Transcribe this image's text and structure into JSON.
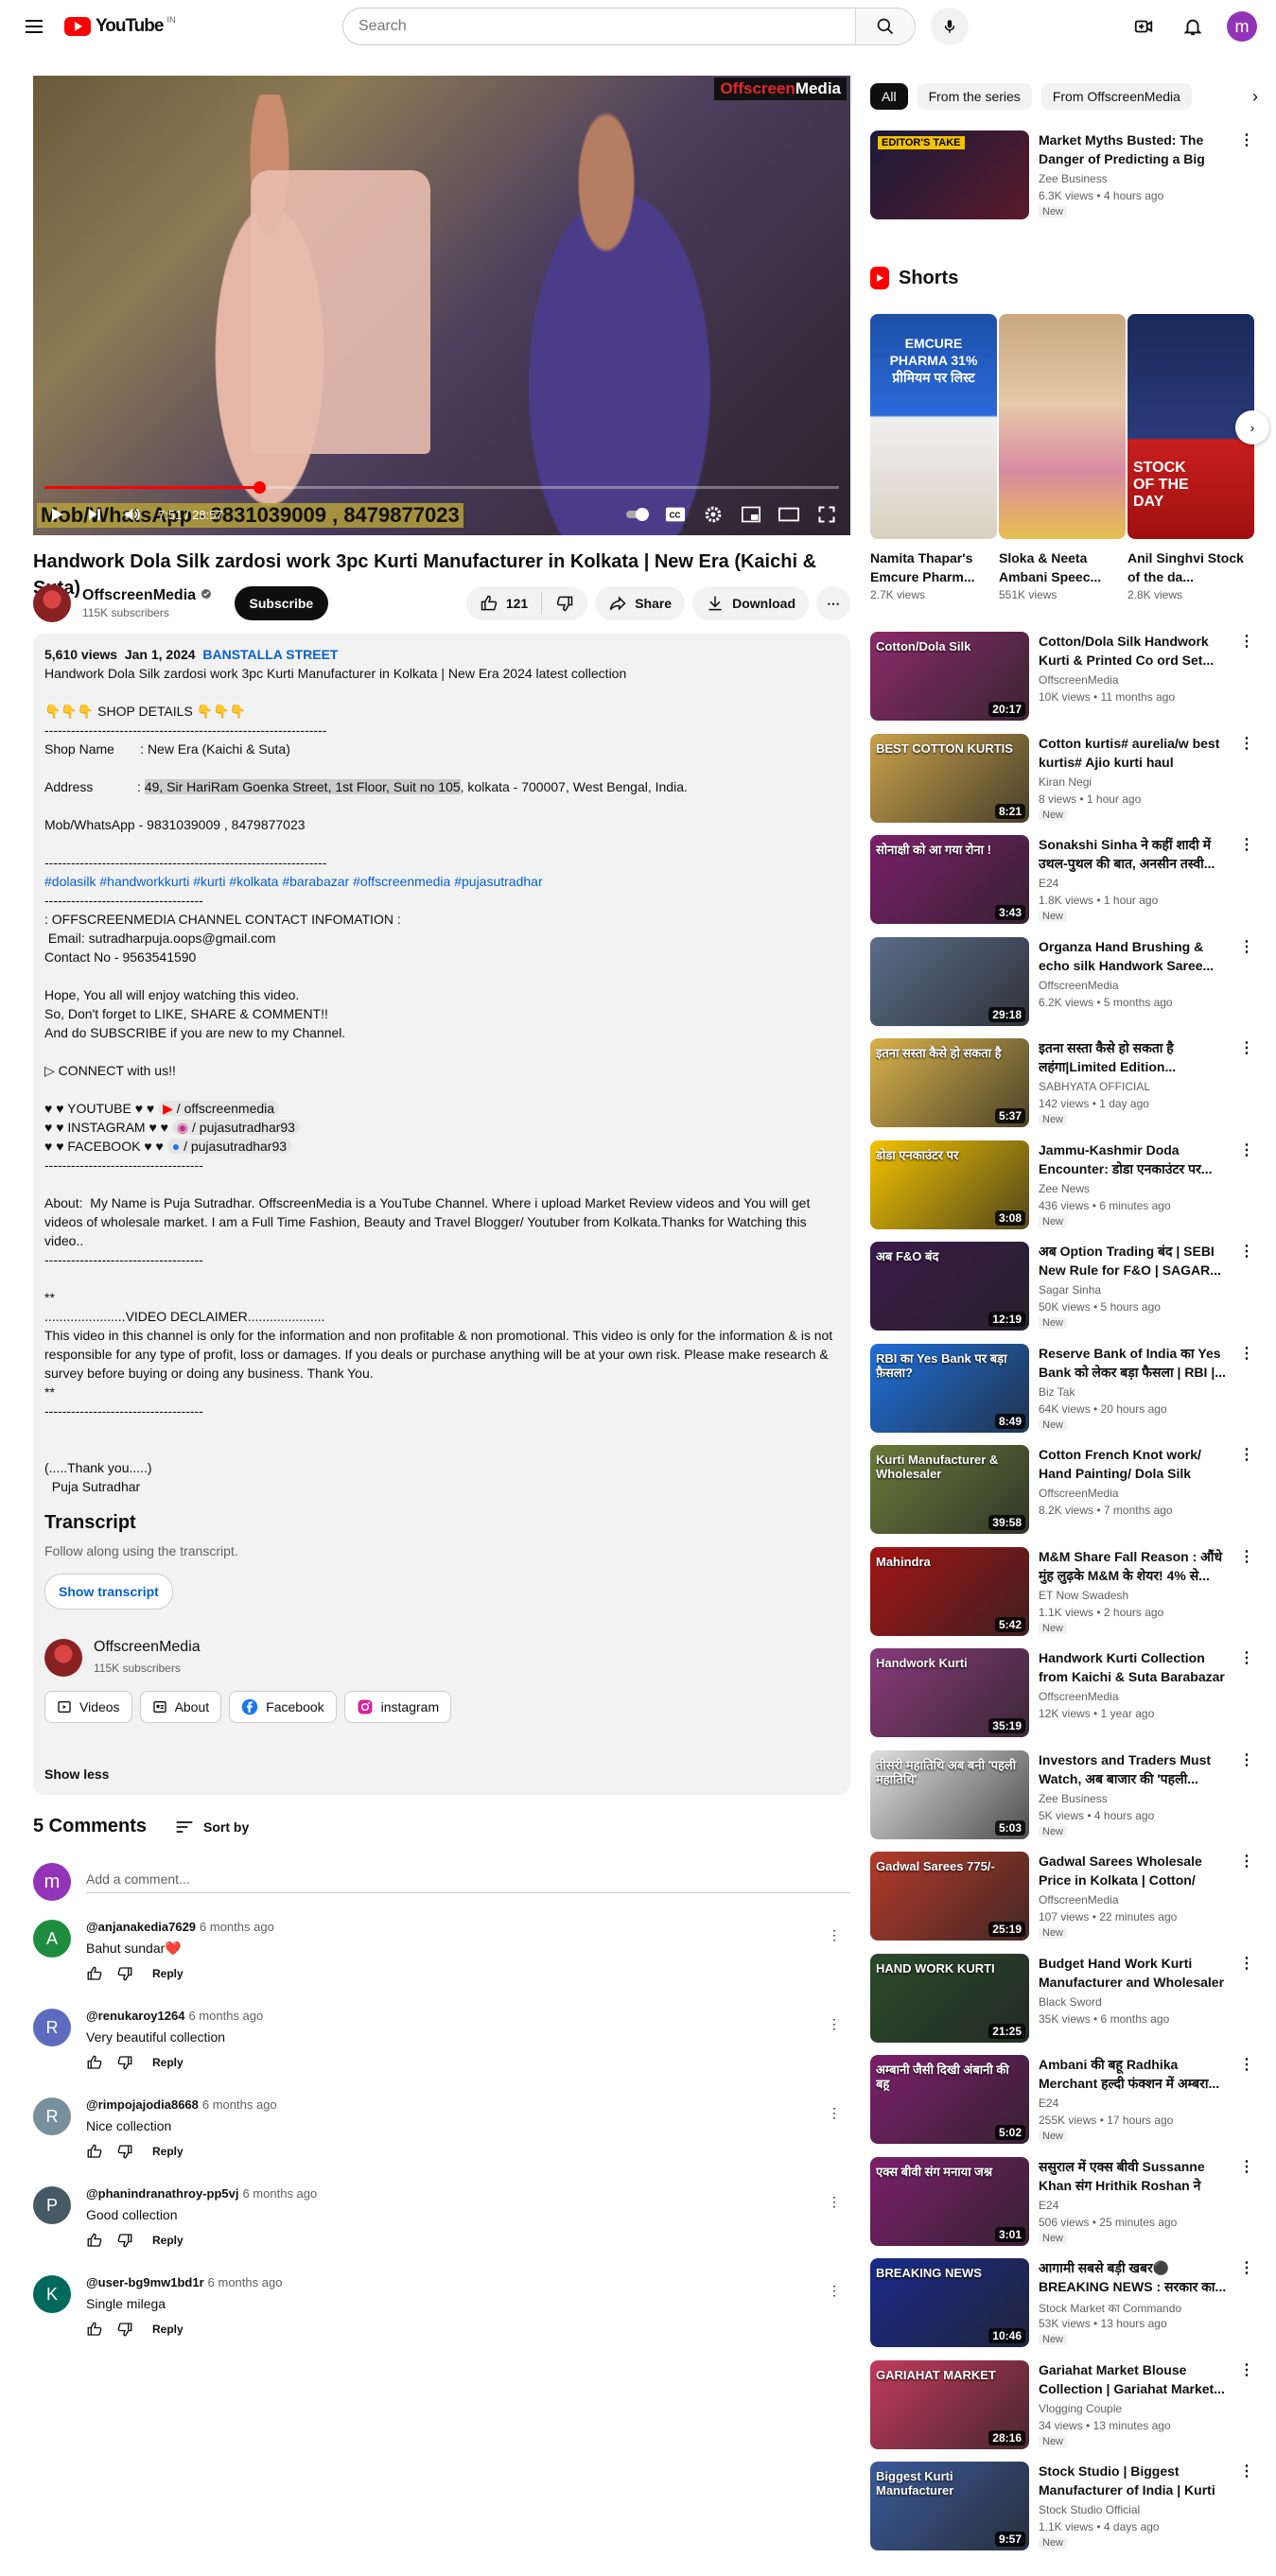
{
  "masthead": {
    "logo_text": "YouTube",
    "country_code": "IN",
    "search_placeholder": "Search",
    "user_initial": "m"
  },
  "player": {
    "brand_left": "Offscreen",
    "brand_right": "Media",
    "overlay_text": "Mob/WhatsApp - 9831039009 , 8479877023",
    "time": "7:51 / 28:57",
    "progress_fraction": 0.27
  },
  "video": {
    "title": "Handwork Dola Silk zardosi work 3pc Kurti Manufacturer in Kolkata | New Era (Kaichi & Suta)",
    "channel": "OffscreenMedia",
    "subscribers": "115K subscribers",
    "subscribe_label": "Subscribe",
    "likes": "121",
    "share_label": "Share",
    "download_label": "Download"
  },
  "description": {
    "views": "5,610 views",
    "date": "Jan 1, 2024",
    "location": "BANSTALLA STREET",
    "line1": "Handwork Dola Silk zardosi work 3pc Kurti Manufacturer in Kolkata | New Era 2024 latest collection",
    "shop_details": "👇👇👇 SHOP DETAILS 👇👇👇",
    "divider1": "----------------------------------------------------------------",
    "shop_name": "Shop Name       : New Era (Kaichi & Suta)",
    "address_label": "Address            : ",
    "address_hl": "49, Sir HariRam Goenka Street, 1st Floor, Suit no 105",
    "address_rest": ", kolkata - 700007, West Bengal, India.",
    "mob": "Mob/WhatsApp - 9831039009 , 8479877023",
    "divider2": "----------------------------------------------------------------",
    "hashtags": "#dolasilk #handworkkurti #kurti #kolkata #barabazar #offscreenmedia #pujasutradhar",
    "divider3": "------------------------------------",
    "contact_h": ": OFFSCREENMEDIA CHANNEL CONTACT INFOMATION :",
    "email": " Email: sutradharpuja.oops@gmail.com",
    "contact_no": "Contact No - 9563541590",
    "hope1": "Hope, You all will enjoy watching this video.",
    "hope2": "So, Don't forget to LIKE, SHARE & COMMENT!!",
    "hope3": "And do SUBSCRIBE if you are new to my Channel.",
    "connect": "▷ CONNECT with us!!",
    "yt_label": "♥ ♥ YOUTUBE ♥ ♥ ",
    "yt_handle": "/ offscreenmedia",
    "ig_label": "♥ ♥ INSTAGRAM ♥ ♥ ",
    "ig_handle": "/ pujasutradhar93",
    "fb_label": "♥ ♥ FACEBOOK ♥ ♥ ",
    "fb_handle": "/ pujasutradhar93",
    "divider4": "------------------------------------",
    "about": "About:  My Name is Puja Sutradhar. OffscreenMedia is a YouTube Channel. Where i upload Market Review videos and You will get videos of wholesale market. I am a Full Time Fashion, Beauty and Travel Blogger/ Youtuber from Kolkata.Thanks for Watching this video..",
    "divider5": "------------------------------------",
    "stars1": "**",
    "disclaimer_h": "......................VIDEO DECLAIMER.....................",
    "disclaimer": "This video in this channel is only for the information and non profitable & non promotional. This video is only for the information & is not responsible for any type of profit, loss or damages. If you deals or purchase anything will be at your own risk. Please make research & survey before buying or doing any business. Thank You.",
    "stars2": "**",
    "divider6": "------------------------------------",
    "thanks": "(.....Thank you.....)",
    "signature": "  Puja Sutradhar",
    "transcript_h": "Transcript",
    "transcript_sub": "Follow along using the transcript.",
    "show_transcript": "Show transcript",
    "channel": "OffscreenMedia",
    "channel_subs": "115K subscribers",
    "link_videos": "Videos",
    "link_about": "About",
    "link_facebook": "Facebook",
    "link_instagram": "instagram",
    "show_less": "Show less"
  },
  "comments": {
    "count": "5 Comments",
    "sort_label": "Sort by",
    "add_placeholder": "Add a comment...",
    "reply_label": "Reply",
    "items": [
      {
        "initial": "A",
        "color": "#1e8e3e",
        "author": "@anjanakedia7629",
        "time": "6 months ago",
        "text": "Bahut sundar❤️"
      },
      {
        "initial": "R",
        "color": "#5c6bc0",
        "author": "@renukaroy1264",
        "time": "6 months ago",
        "text": "Very beautiful collection"
      },
      {
        "initial": "R",
        "color": "#78909c",
        "author": "@rimpojajodia8668",
        "time": "6 months ago",
        "text": "Nice collection"
      },
      {
        "initial": "P",
        "color": "#455a64",
        "author": "@phanindranathroy-pp5vj",
        "time": "6 months ago",
        "text": "Good collection"
      },
      {
        "initial": "K",
        "color": "#00695c",
        "author": "@user-bg9mw1bd1r",
        "time": "6 months ago",
        "text": "Single milega"
      }
    ]
  },
  "sidebar": {
    "chips": [
      "All",
      "From the series",
      "From OffscreenMedia"
    ],
    "first_video": {
      "title": "Market Myths Busted: The Danger of Predicting a Big Dro...",
      "channel": "Zee Business",
      "meta": "6.3K views • 4 hours ago",
      "badge": "New",
      "thumb": "EDITOR'S TAKE"
    },
    "shorts_title": "Shorts",
    "shorts": [
      {
        "title": "Namita Thapar's Emcure Pharm...",
        "views": "2.7K views",
        "caption": "EMCURE PHARMA 31% प्रीमियम पर लिस्ट"
      },
      {
        "title": "Sloka & Neeta Ambani Speec...",
        "views": "551K views",
        "caption": ""
      },
      {
        "title": "Anil Singhvi Stock of the da...",
        "views": "2.8K views",
        "caption": "STOCK OF THE DAY"
      }
    ],
    "videos": [
      {
        "title": "Cotton/Dola Silk Handwork Kurti & Printed Co ord Set...",
        "channel": "OffscreenMedia",
        "meta": "10K views • 11 months ago",
        "badge": "",
        "dur": "20:17",
        "thumb": "Cotton/Dola Silk",
        "bg": "#8a2a6a"
      },
      {
        "title": "Cotton kurtis# aurelia/w best kurtis# Ajio kurti haul #kurtiha...",
        "channel": "Kiran Negi",
        "meta": "8 views • 1 hour ago",
        "badge": "New",
        "dur": "8:21",
        "thumb": "BEST COTTON KURTIS",
        "bg": "#c9a14a"
      },
      {
        "title": "Sonakshi Sinha ने कहीं शादी में उथल-पुथल की बात, अनसीन तस्वी...",
        "channel": "E24",
        "meta": "1.8K views • 1 hour ago",
        "badge": "New",
        "dur": "3:43",
        "thumb": "सोनाक्षी को आ गया रोना !",
        "bg": "#7b1f6a"
      },
      {
        "title": "Organza Hand Brushing & echo silk Handwork Saree...",
        "channel": "OffscreenMedia",
        "meta": "6.2K views • 5 months ago",
        "badge": "",
        "dur": "29:18",
        "thumb": "",
        "bg": "#5a6d8a"
      },
      {
        "title": "इतना सस्ता कैसे हो सकता है लहंगा|Limited Edition...",
        "channel": "SABHYATA OFFICIAL",
        "meta": "142 views • 1 day ago",
        "badge": "New",
        "dur": "5:37",
        "thumb": "इतना सस्ता कैसे हो सकता है",
        "bg": "#d9b24a"
      },
      {
        "title": "Jammu-Kashmir Doda Encounter: डोडा एनकाउंटर पर...",
        "channel": "Zee News",
        "meta": "436 views • 6 minutes ago",
        "badge": "New",
        "dur": "3:08",
        "thumb": "डोडा एनकाउंटर पर",
        "bg": "#f2c200"
      },
      {
        "title": "अब Option Trading बंद | SEBI New Rule for F&O | SAGAR...",
        "channel": "Sagar Sinha",
        "meta": "50K views • 5 hours ago",
        "badge": "New",
        "dur": "12:19",
        "thumb": "अब F&O बंद",
        "bg": "#3a1a4a"
      },
      {
        "title": "Reserve Bank of India का Yes Bank को लेकर बड़ा फैसला | RBI |...",
        "channel": "Biz Tak",
        "meta": "64K views • 20 hours ago",
        "badge": "New",
        "dur": "8:49",
        "thumb": "RBI का Yes Bank पर बड़ा फ़ैसला?",
        "bg": "#1e6fd9"
      },
      {
        "title": "Cotton French Knot work/ Hand Painting/ Dola Silk Wholesale...",
        "channel": "OffscreenMedia",
        "meta": "8.2K views • 7 months ago",
        "badge": "",
        "dur": "39:58",
        "thumb": "Kurti Manufacturer & Wholesaler",
        "bg": "#6a7a3a"
      },
      {
        "title": "M&M Share Fall Reason : औंधे मुंह लुढ़के M&M के शेयर! 4% से...",
        "channel": "ET Now Swadesh",
        "meta": "1.1K views • 2 hours ago",
        "badge": "New",
        "dur": "5:42",
        "thumb": "Mahindra",
        "bg": "#a31515"
      },
      {
        "title": "Handwork Kurti Collection from Kaichi & Suta Barabazar Kolkata",
        "channel": "OffscreenMedia",
        "meta": "12K views • 1 year ago",
        "badge": "",
        "dur": "35:19",
        "thumb": "Handwork Kurti",
        "bg": "#8a3a7a"
      },
      {
        "title": "Investors and Traders Must Watch, अब बाजार की 'पहली...",
        "channel": "Zee Business",
        "meta": "5K views • 4 hours ago",
        "badge": "New",
        "dur": "5:03",
        "thumb": "तीसरी महातिथि अब बनी 'पहली महातिथि'",
        "bg": "#e0e0e0"
      },
      {
        "title": "Gadwal Sarees Wholesale Price in Kolkata | Cotton/ Sico/ Silk...",
        "channel": "OffscreenMedia",
        "meta": "107 views • 22 minutes ago",
        "badge": "New",
        "dur": "25:19",
        "thumb": "Gadwal Sarees 775/-",
        "bg": "#b33a2a"
      },
      {
        "title": "Budget Hand Work Kurti Manufacturer and Wholesaler ...",
        "channel": "Black Sword",
        "meta": "35K views • 6 months ago",
        "badge": "",
        "dur": "21:25",
        "thumb": "HAND WORK KURTI",
        "bg": "#2a4a2a"
      },
      {
        "title": "Ambani की बहू Radhika Merchant हल्दी फंक्शन में अम्बरा...",
        "channel": "E24",
        "meta": "255K views • 17 hours ago",
        "badge": "New",
        "dur": "5:02",
        "thumb": "अम्बानी जैसी दिखी अंबानी की बहू",
        "bg": "#7b1f6a"
      },
      {
        "title": "ससुराल में एक्स बीवी Sussanne Khan संग Hrithik Roshan ने की...",
        "channel": "E24",
        "meta": "506 views • 25 minutes ago",
        "badge": "New",
        "dur": "3:01",
        "thumb": "एक्स बीवी संग मनाया जश्न",
        "bg": "#7b1f6a"
      },
      {
        "title": "आगामी सबसे बड़ी खबर⚫ BREAKING NEWS : सरकार का...",
        "channel": "Stock Market का Commando",
        "meta": "53K views • 13 hours ago",
        "badge": "New",
        "dur": "10:46",
        "thumb": "BREAKING NEWS",
        "bg": "#1a2a8a"
      },
      {
        "title": "Gariahat Market Blouse Collection | Gariahat Market...",
        "channel": "Vlogging Couple",
        "meta": "34 views • 13 minutes ago",
        "badge": "New",
        "dur": "28:16",
        "thumb": "GARIAHAT MARKET",
        "bg": "#c23a5a"
      },
      {
        "title": "Stock Studio | Biggest Manufacturer of India | Kurti |...",
        "channel": "Stock Studio Official",
        "meta": "1.1K views • 4 days ago",
        "badge": "New",
        "dur": "9:57",
        "thumb": "Biggest Kurti Manufacturer",
        "bg": "#3a5a9a"
      }
    ]
  }
}
